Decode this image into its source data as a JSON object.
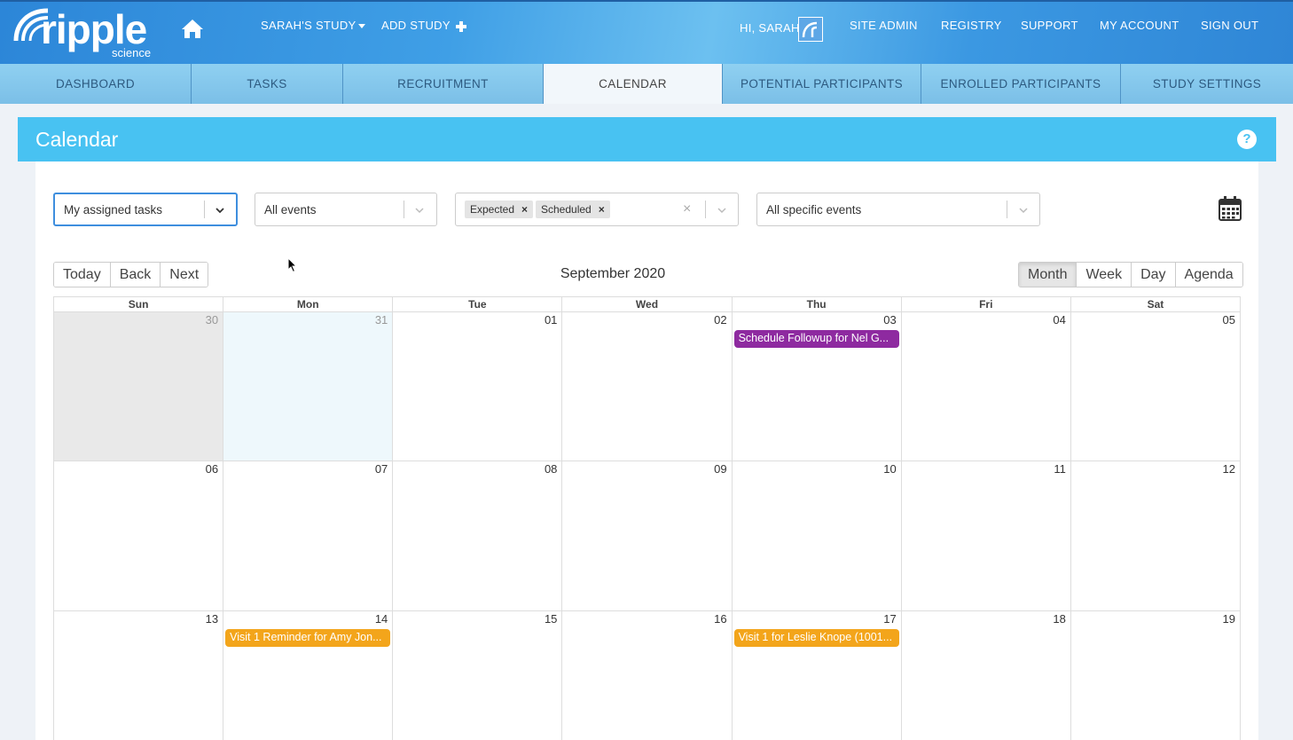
{
  "header": {
    "logo_text": "ripple",
    "logo_sub": "science",
    "study_menu": "SARAH'S STUDY",
    "add_study": "ADD STUDY",
    "greeting": "HI, SARAH",
    "links": [
      "SITE ADMIN",
      "REGISTRY",
      "SUPPORT",
      "MY ACCOUNT",
      "SIGN OUT"
    ]
  },
  "tabs": [
    {
      "label": "DASHBOARD"
    },
    {
      "label": "TASKS"
    },
    {
      "label": "RECRUITMENT"
    },
    {
      "label": "CALENDAR"
    },
    {
      "label": "POTENTIAL PARTICIPANTS"
    },
    {
      "label": "ENROLLED PARTICIPANTS"
    },
    {
      "label": "STUDY SETTINGS"
    }
  ],
  "panel": {
    "title": "Calendar",
    "help": "?"
  },
  "filters": {
    "assigned": "My assigned tasks",
    "events": "All events",
    "chips": [
      "Expected",
      "Scheduled"
    ],
    "specific": "All specific events"
  },
  "toolbar": {
    "nav": [
      "Today",
      "Back",
      "Next"
    ],
    "month_label": "September 2020",
    "views": [
      "Month",
      "Week",
      "Day",
      "Agenda"
    ],
    "active_view": "Month"
  },
  "calendar": {
    "weekdays": [
      "Sun",
      "Mon",
      "Tue",
      "Wed",
      "Thu",
      "Fri",
      "Sat"
    ],
    "weeks": [
      [
        {
          "day": "30",
          "state": "off"
        },
        {
          "day": "31",
          "state": "today"
        },
        {
          "day": "01"
        },
        {
          "day": "02"
        },
        {
          "day": "03",
          "event": {
            "text": "Schedule Followup for Nel G...",
            "color": "#8e2aa0",
            "kind": "purple"
          }
        },
        {
          "day": "04"
        },
        {
          "day": "05"
        }
      ],
      [
        {
          "day": "06"
        },
        {
          "day": "07"
        },
        {
          "day": "08"
        },
        {
          "day": "09"
        },
        {
          "day": "10"
        },
        {
          "day": "11"
        },
        {
          "day": "12"
        }
      ],
      [
        {
          "day": "13"
        },
        {
          "day": "14",
          "event": {
            "text": "Visit 1 Reminder for Amy Jon...",
            "color": "#f3a51b",
            "kind": "orange"
          }
        },
        {
          "day": "15"
        },
        {
          "day": "16"
        },
        {
          "day": "17",
          "event": {
            "text": "Visit 1 for Leslie Knope (1001...",
            "color": "#f3a51b",
            "kind": "orange"
          }
        },
        {
          "day": "18"
        },
        {
          "day": "19"
        }
      ]
    ]
  },
  "colors": {
    "header_blue": "#3f9fe6",
    "panel_blue": "#48c2f2",
    "purple_event": "#8e2aa0",
    "orange_event": "#f3a51b"
  }
}
